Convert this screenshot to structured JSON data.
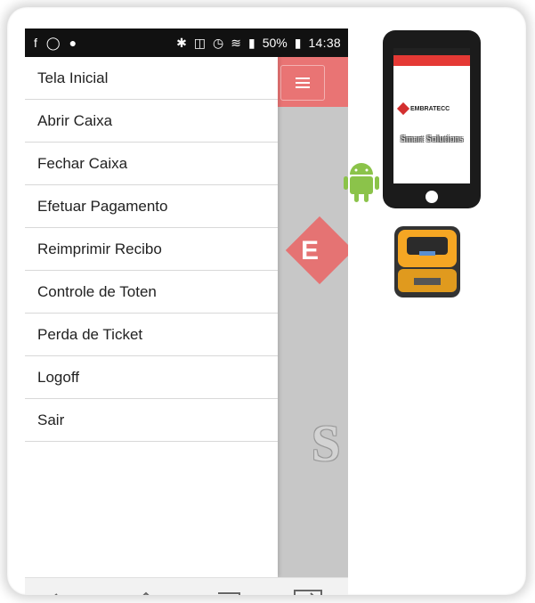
{
  "status_bar": {
    "battery_percent": "50%",
    "time": "14:38"
  },
  "drawer": {
    "items": [
      {
        "label": "Tela Inicial"
      },
      {
        "label": "Abrir Caixa"
      },
      {
        "label": "Fechar Caixa"
      },
      {
        "label": "Efetuar Pagamento"
      },
      {
        "label": "Reimprimir Recibo"
      },
      {
        "label": "Controle de Toten"
      },
      {
        "label": "Perda de Ticket"
      },
      {
        "label": "Logoff"
      },
      {
        "label": "Sair"
      }
    ]
  },
  "background_app": {
    "menu_icon": "hamburger-icon",
    "logo_letter": "E",
    "partial_text": "S"
  },
  "navbar": {
    "icons": [
      "back-icon",
      "home-icon",
      "recent-apps-icon",
      "switch-icon"
    ]
  },
  "device_illustration": {
    "brand": "EMBRATECC",
    "slogan": "Smart Solutions"
  },
  "colors": {
    "header_red": "#e97474",
    "drawer_bg": "#ffffff",
    "android_green": "#8bc34a",
    "printer_orange": "#f5a623"
  }
}
